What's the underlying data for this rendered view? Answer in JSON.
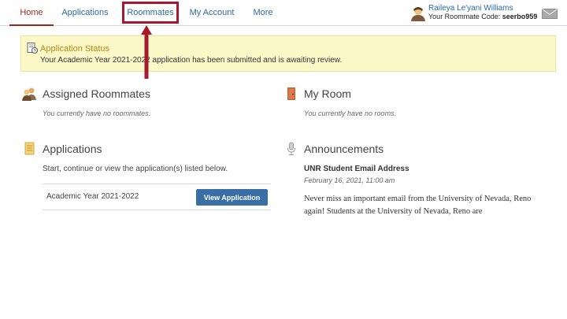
{
  "nav": {
    "tabs": [
      {
        "label": "Home"
      },
      {
        "label": "Applications"
      },
      {
        "label": "Roommates"
      },
      {
        "label": "My Account"
      },
      {
        "label": "More"
      }
    ]
  },
  "user": {
    "name": "Raileya Le'yani Williams",
    "code_label": "Your Roommate Code:",
    "code": "seerbo959"
  },
  "alert": {
    "title": "Application Status",
    "text": "Your Academic Year 2021-2022 application has been submitted and is awaiting review."
  },
  "assigned_roommates": {
    "title": "Assigned Roommates",
    "empty": "You currently have no roommates."
  },
  "my_room": {
    "title": "My Room",
    "empty": "You currently have no rooms."
  },
  "applications": {
    "title": "Applications",
    "intro": "Start, continue or view the application(s) listed below.",
    "items": [
      {
        "label": "Academic Year 2021-2022",
        "button": "View Application"
      }
    ]
  },
  "announcements": {
    "title": "Announcements",
    "items": [
      {
        "title": "UNR Student Email Address",
        "date": "February 16, 2021, 11:00 am",
        "body": "Never miss an important email from the University of Nevada, Reno again! Students at the University of Nevada, Reno are"
      }
    ]
  },
  "colors": {
    "accent_red": "#9c2a1c",
    "link_blue": "#2a6aa8",
    "alert_bg": "#fdf8c8",
    "button_blue": "#3a6fa6",
    "annotation_red": "#a8182b"
  }
}
